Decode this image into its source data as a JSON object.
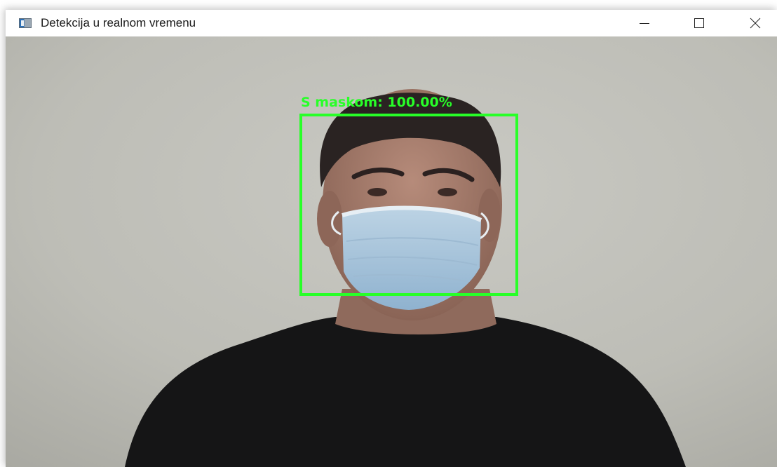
{
  "window": {
    "title": "Detekcija u realnom vremenu",
    "icon": "app-window-icon",
    "controls": {
      "minimize_icon": "minimize-icon",
      "maximize_icon": "maximize-icon",
      "close_icon": "close-icon"
    }
  },
  "detection": {
    "label": "S maskom: 100.00%",
    "box_color": "#28ff28"
  }
}
